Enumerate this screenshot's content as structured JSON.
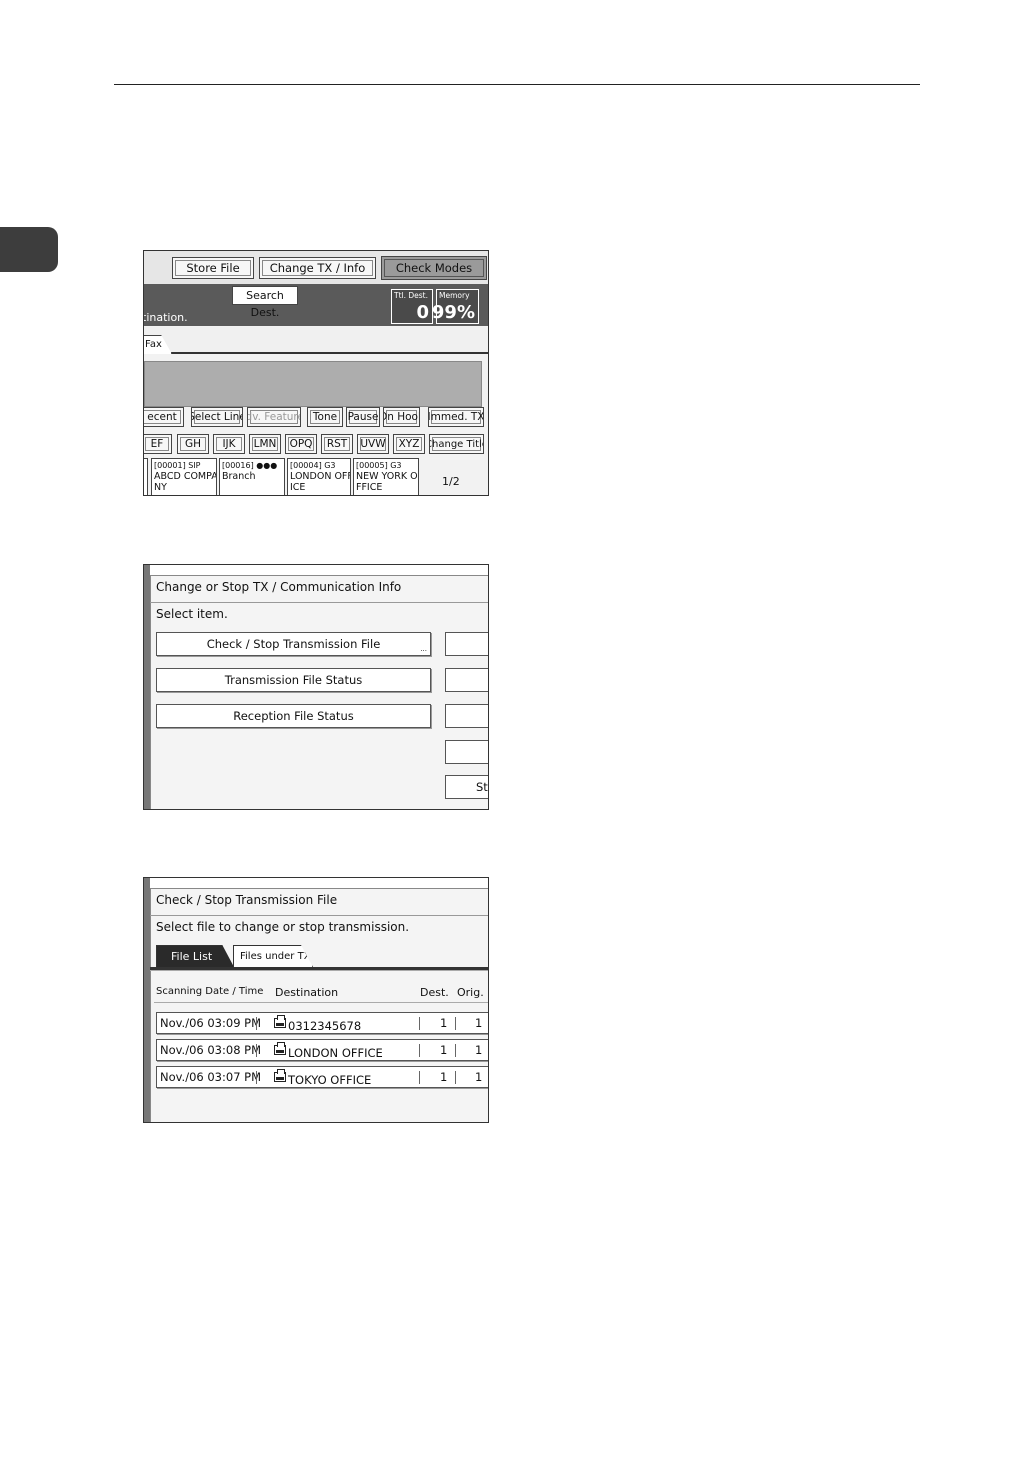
{
  "screen1": {
    "top_buttons": [
      "Store File",
      "Change TX / Info",
      "Check Modes"
    ],
    "search_dest": "Search Dest.",
    "status_text": "tination.",
    "ttl_dest_label": "Ttl. Dest.",
    "ttl_dest_value": "0",
    "memory_label": "Memory",
    "memory_value": "99%",
    "fax_tab": "Fax",
    "row1_buttons": [
      "ecent",
      "Select Line",
      "Adv. Features",
      "Tone",
      "Pause",
      "On Hook",
      "Immed. TX"
    ],
    "row2_buttons": [
      "EF",
      "GH",
      "IJK",
      "LMN",
      "OPQ",
      "RST",
      "UVW",
      "XYZ",
      "Change Title"
    ],
    "destinations": [
      {
        "code": "[00001] SIP",
        "line1": "ABCD COMPA",
        "line2": "NY"
      },
      {
        "code": "[00016]",
        "line1": "Branch",
        "line2": ""
      },
      {
        "code": "[00004] G3",
        "line1": "LONDON OFF",
        "line2": "ICE"
      },
      {
        "code": "[00005] G3",
        "line1": "NEW YORK O",
        "line2": "FFICE"
      }
    ],
    "page_indicator": "1/2"
  },
  "screen2": {
    "title": "Change or Stop TX / Communication Info",
    "prompt": "Select item.",
    "buttons": [
      "Check / Stop Transmission File",
      "Transmission File Status",
      "Reception File Status"
    ],
    "right_partial_button": "St"
  },
  "screen3": {
    "title": "Check / Stop Transmission File",
    "prompt": "Select file to change or stop transmission.",
    "tabs": [
      "File List",
      "Files under TX"
    ],
    "columns": [
      "Scanning Date / Time",
      "Destination",
      "Dest.",
      "Orig."
    ],
    "rows": [
      {
        "datetime": "Nov./06  03:09 PM",
        "destination": "0312345678",
        "dest": "1",
        "orig": "1"
      },
      {
        "datetime": "Nov./06  03:08 PM",
        "destination": "LONDON OFFICE",
        "dest": "1",
        "orig": "1"
      },
      {
        "datetime": "Nov./06  03:07 PM",
        "destination": "TOKYO OFFICE",
        "dest": "1",
        "orig": "1"
      }
    ]
  }
}
